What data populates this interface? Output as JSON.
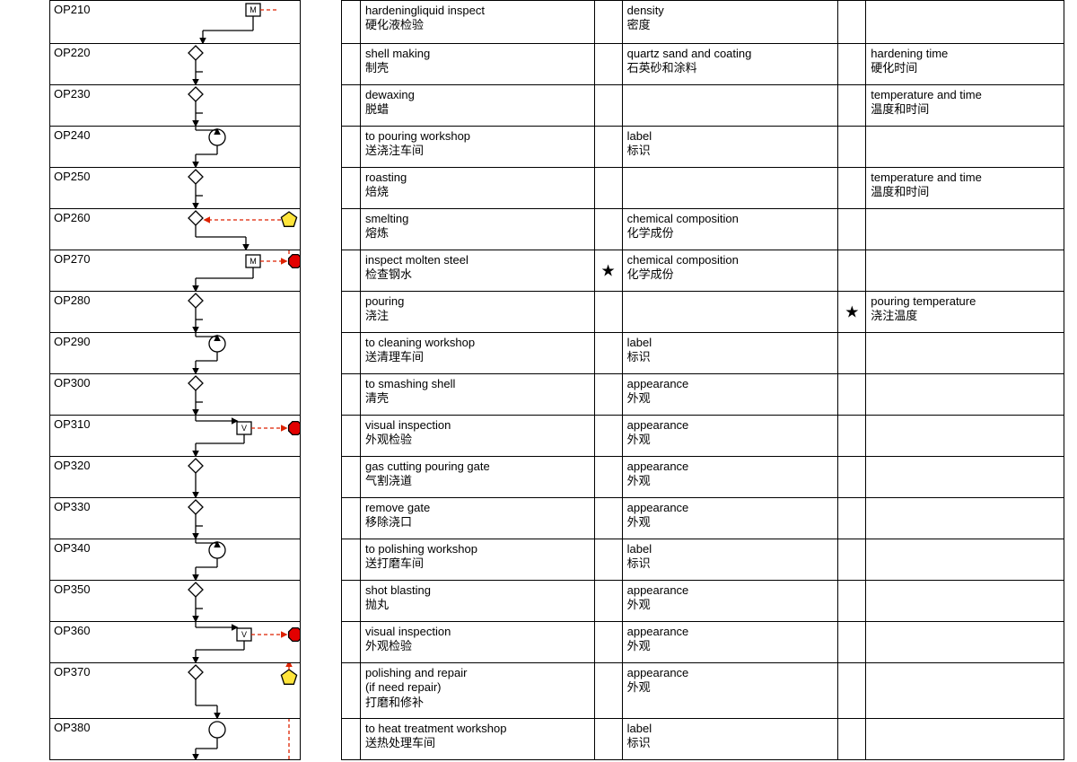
{
  "rows": [
    {
      "id": "OP210",
      "h": 47,
      "desc_en": "hardeningliquid inspect",
      "desc_cn": "硬化液检验",
      "c2_en": "density",
      "c2_cn": "密度",
      "c3_en": "",
      "c3_cn": "",
      "flow": "m_entry"
    },
    {
      "id": "OP220",
      "h": 45,
      "desc_en": "shell making",
      "desc_cn": "制壳",
      "c2_en": "quartz sand and coating",
      "c2_cn": "石英砂和涂料",
      "c3_en": "hardening time",
      "c3_cn": "硬化时间",
      "flow": "diamond_step"
    },
    {
      "id": "OP230",
      "h": 45,
      "desc_en": "dewaxing",
      "desc_cn": "脱蜡",
      "c2_en": "",
      "c2_cn": "",
      "c3_en": "temperature and time",
      "c3_cn": "温度和时间",
      "flow": "diamond_step"
    },
    {
      "id": "OP240",
      "h": 45,
      "desc_en": "to pouring workshop",
      "desc_cn": "送浇注车间",
      "c2_en": "label",
      "c2_cn": "标识",
      "c3_en": "",
      "c3_cn": "",
      "flow": "circle_step"
    },
    {
      "id": "OP250",
      "h": 45,
      "desc_en": "roasting",
      "desc_cn": "焙烧",
      "c2_en": "",
      "c2_cn": "",
      "c3_en": "temperature and time",
      "c3_cn": "温度和时间",
      "flow": "diamond_step"
    },
    {
      "id": "OP260",
      "h": 45,
      "desc_en": "smelting",
      "desc_cn": "熔炼",
      "c2_en": "chemical composition",
      "c2_cn": "化学成份",
      "c3_en": "",
      "c3_cn": "",
      "flow": "diamond_from_pentagon"
    },
    {
      "id": "OP270",
      "h": 45,
      "desc_en": "inspect molten steel",
      "desc_cn": "检查钢水",
      "c2_en": "chemical composition",
      "c2_cn": "化学成份",
      "c3_en": "",
      "c3_cn": "",
      "star1": true,
      "flow": "m_to_octagon_up"
    },
    {
      "id": "OP280",
      "h": 45,
      "desc_en": "pouring",
      "desc_cn": "浇注",
      "c2_en": "",
      "c2_cn": "",
      "c3_en": "pouring temperature",
      "c3_cn": "浇注温度",
      "star2": true,
      "flow": "diamond_step"
    },
    {
      "id": "OP290",
      "h": 45,
      "desc_en": "to cleaning workshop",
      "desc_cn": "送清理车间",
      "c2_en": "label",
      "c2_cn": "标识",
      "c3_en": "",
      "c3_cn": "",
      "flow": "circle_step"
    },
    {
      "id": "OP300",
      "h": 45,
      "desc_en": "to smashing shell",
      "desc_cn": "清壳",
      "c2_en": "appearance",
      "c2_cn": "外观",
      "c3_en": "",
      "c3_cn": "",
      "flow": "diamond_step"
    },
    {
      "id": "OP310",
      "h": 45,
      "desc_en": "visual inspection",
      "desc_cn": "外观检验",
      "c2_en": "appearance",
      "c2_cn": "外观",
      "c3_en": "",
      "c3_cn": "",
      "flow": "v_to_octagon"
    },
    {
      "id": "OP320",
      "h": 45,
      "desc_en": "gas cutting pouring gate",
      "desc_cn": "气割浇道",
      "c2_en": "appearance",
      "c2_cn": "外观",
      "c3_en": "",
      "c3_cn": "",
      "flow": "diamond_step2"
    },
    {
      "id": "OP330",
      "h": 45,
      "desc_en": "remove gate",
      "desc_cn": "移除浇口",
      "c2_en": "appearance",
      "c2_cn": "外观",
      "c3_en": "",
      "c3_cn": "",
      "flow": "diamond_step"
    },
    {
      "id": "OP340",
      "h": 45,
      "desc_en": "to polishing workshop",
      "desc_cn": "送打磨车间",
      "c2_en": "label",
      "c2_cn": "标识",
      "c3_en": "",
      "c3_cn": "",
      "flow": "circle_step"
    },
    {
      "id": "OP350",
      "h": 45,
      "desc_en": "shot blasting",
      "desc_cn": "抛丸",
      "c2_en": "appearance",
      "c2_cn": "外观",
      "c3_en": "",
      "c3_cn": "",
      "flow": "diamond_step"
    },
    {
      "id": "OP360",
      "h": 45,
      "desc_en": "visual inspection",
      "desc_cn": "外观检验",
      "c2_en": "appearance",
      "c2_cn": "外观",
      "c3_en": "",
      "c3_cn": "",
      "flow": "v_to_octagon"
    },
    {
      "id": "OP370",
      "h": 61,
      "desc_en": "polishing and repair\n(if need repair)",
      "desc_cn": "打磨和修补",
      "c2_en": "appearance",
      "c2_cn": "外观",
      "c3_en": "",
      "c3_cn": "",
      "flow": "diamond_pentagon_up"
    },
    {
      "id": "OP380",
      "h": 45,
      "desc_en": "to heat treatment workshop",
      "desc_cn": "送热处理车间",
      "c2_en": "label",
      "c2_cn": "标识",
      "c3_en": "",
      "c3_cn": "",
      "flow": "circle_tail"
    }
  ]
}
